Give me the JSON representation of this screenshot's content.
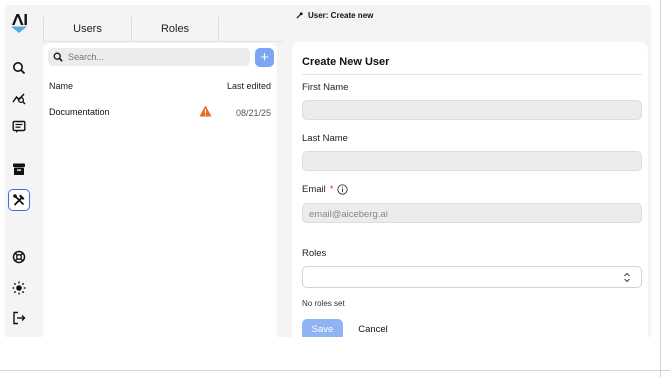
{
  "sidebar": {
    "logo": "aiceberg-logo",
    "icons": [
      "search-icon",
      "analytics-icon",
      "messages-icon",
      "archive-icon",
      "tools-icon",
      "support-icon",
      "theme-icon",
      "logout-icon"
    ],
    "active": "tools-icon"
  },
  "tabs": [
    {
      "label": "Users"
    },
    {
      "label": "Roles"
    }
  ],
  "breadcrumb": {
    "text": "User: Create new"
  },
  "list": {
    "search_placeholder": "Search...",
    "add_label": "+",
    "columns": {
      "name": "Name",
      "edited": "Last edited"
    },
    "rows": [
      {
        "name": "Documentation",
        "status": "warning",
        "date": "08/21/25"
      }
    ]
  },
  "form": {
    "title": "Create New User",
    "first_name_label": "First Name",
    "first_name_value": "",
    "last_name_label": "Last Name",
    "last_name_value": "",
    "email_label": "Email",
    "email_required": "*",
    "email_placeholder": "email@aiceberg.ai",
    "roles_label": "Roles",
    "roles_value": "",
    "roles_hint": "No roles set",
    "save_label": "Save",
    "cancel_label": "Cancel"
  },
  "colors": {
    "accent": "#3b6fe0",
    "primary_button": "#8fb3f3",
    "warning": "#e86a1c",
    "required": "#e0342b"
  }
}
